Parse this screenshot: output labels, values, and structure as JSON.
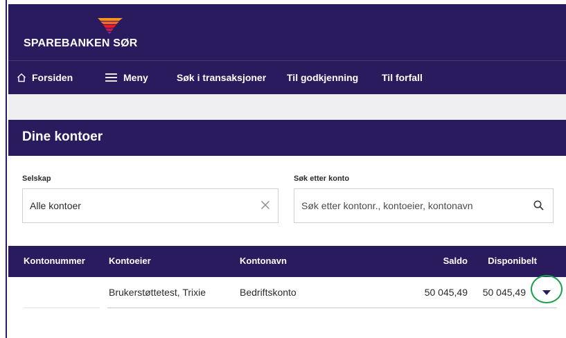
{
  "brand": {
    "name": "SPAREBANKEN SØR",
    "logo_icon": "sparebanken-wave-logo",
    "primary_color": "#2a1a5e"
  },
  "nav": {
    "items": [
      {
        "label": "Forsiden",
        "icon": "home-icon"
      },
      {
        "label": "Meny",
        "icon": "hamburger-menu-icon"
      },
      {
        "label": "Søk i transaksjoner"
      },
      {
        "label": "Til godkjenning"
      },
      {
        "label": "Til forfall"
      }
    ]
  },
  "page": {
    "title": "Dine kontoer"
  },
  "filters": {
    "company": {
      "label": "Selskap",
      "value": "Alle kontoer",
      "clear_icon": "close-icon"
    },
    "search": {
      "label": "Søk etter konto",
      "placeholder": "Søk etter kontonr., kontoeier, kontonavn",
      "icon": "search-icon"
    }
  },
  "table": {
    "columns": [
      "Kontonummer",
      "Kontoeier",
      "Kontonavn",
      "Saldo",
      "Disponibelt"
    ],
    "rows": [
      {
        "kontonummer": "",
        "kontoeier": "Brukerstøttetest, Trixie",
        "kontonavn": "Bedriftskonto",
        "saldo": "50 045,49",
        "disponibelt": "50 045,49"
      }
    ]
  },
  "highlight_color": "#1aa04a"
}
